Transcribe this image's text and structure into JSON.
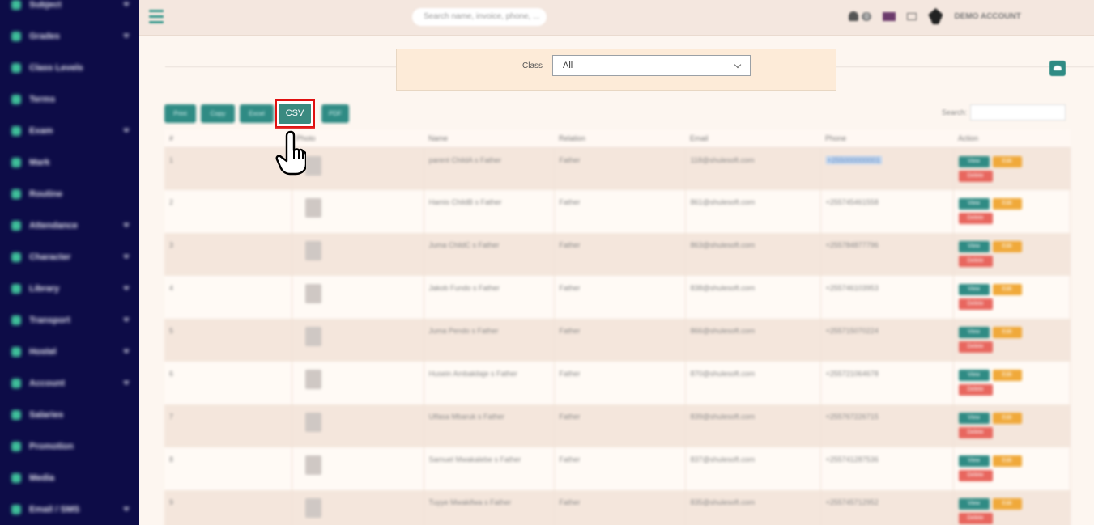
{
  "sidebar": {
    "items": [
      {
        "label": "Subject",
        "chevron": true
      },
      {
        "label": "Grades",
        "chevron": true
      },
      {
        "label": "Class Levels",
        "chevron": false
      },
      {
        "label": "Terms",
        "chevron": false
      },
      {
        "label": "Exam",
        "chevron": true
      },
      {
        "label": "Mark",
        "chevron": false
      },
      {
        "label": "Routine",
        "chevron": false
      },
      {
        "label": "Attendance",
        "chevron": true
      },
      {
        "label": "Character",
        "chevron": true
      },
      {
        "label": "Library",
        "chevron": true
      },
      {
        "label": "Transport",
        "chevron": true
      },
      {
        "label": "Hostel",
        "chevron": true
      },
      {
        "label": "Account",
        "chevron": true
      },
      {
        "label": "Salaries",
        "chevron": false
      },
      {
        "label": "Promotion",
        "chevron": false
      },
      {
        "label": "Media",
        "chevron": false
      },
      {
        "label": "Email / SMS",
        "chevron": true
      }
    ]
  },
  "topbar": {
    "search_placeholder": "Search name, invoice, phone, ...",
    "notification_count": "0",
    "account_label": "DEMO ACCOUNT"
  },
  "filter": {
    "class_label": "Class",
    "class_value": "All"
  },
  "export": {
    "buttons": [
      "Print",
      "Copy",
      "Excel",
      "CSV",
      "PDF"
    ],
    "highlighted": "CSV"
  },
  "search": {
    "label": "Search:"
  },
  "table": {
    "columns": [
      "#",
      "Photo",
      "Name",
      "Relation",
      "Email",
      "Phone",
      "Action"
    ],
    "actions": {
      "view": "View",
      "edit": "Edit",
      "delete": "Delete"
    },
    "rows": [
      {
        "num": "1",
        "name": "parent ChildA s Father",
        "relation": "Father",
        "email": "118@shulesoft.com",
        "phone": "+255000000001"
      },
      {
        "num": "2",
        "name": "Hamis ChildB s Father",
        "relation": "Father",
        "email": "861@shulesoft.com",
        "phone": "+255745461558"
      },
      {
        "num": "3",
        "name": "Juma ChildC s Father",
        "relation": "Father",
        "email": "863@shulesoft.com",
        "phone": "+255784877796"
      },
      {
        "num": "4",
        "name": "Jakob Fundo s Father",
        "relation": "Father",
        "email": "838@shulesoft.com",
        "phone": "+255746103953"
      },
      {
        "num": "5",
        "name": "Juma Pendo s Father",
        "relation": "Father",
        "email": "866@shulesoft.com",
        "phone": "+255715070224"
      },
      {
        "num": "6",
        "name": "Husein Ambakilaje s Father",
        "relation": "Father",
        "email": "870@shulesoft.com",
        "phone": "+255721064678"
      },
      {
        "num": "7",
        "name": "Ulfasa Mbaruk s Father",
        "relation": "Father",
        "email": "839@shulesoft.com",
        "phone": "+255767226715"
      },
      {
        "num": "8",
        "name": "Samuel Mwakalebe s Father",
        "relation": "Father",
        "email": "837@shulesoft.com",
        "phone": "+255741287536"
      },
      {
        "num": "9",
        "name": "Tuyye Mwakifwa s Father",
        "relation": "Father",
        "email": "835@shulesoft.com",
        "phone": "+255745712952"
      }
    ]
  },
  "colors": {
    "sidebar_bg": "#0d0c47",
    "accent": "#2f8b84",
    "highlight": "#e01010",
    "edit": "#f0a93a",
    "delete": "#e8665e"
  },
  "icons": [
    "hamburger-icon",
    "bell-icon",
    "flag-icon",
    "mail-icon",
    "avatar-icon",
    "cloud-download-icon",
    "chevron-down-icon",
    "pointing-hand-icon"
  ]
}
